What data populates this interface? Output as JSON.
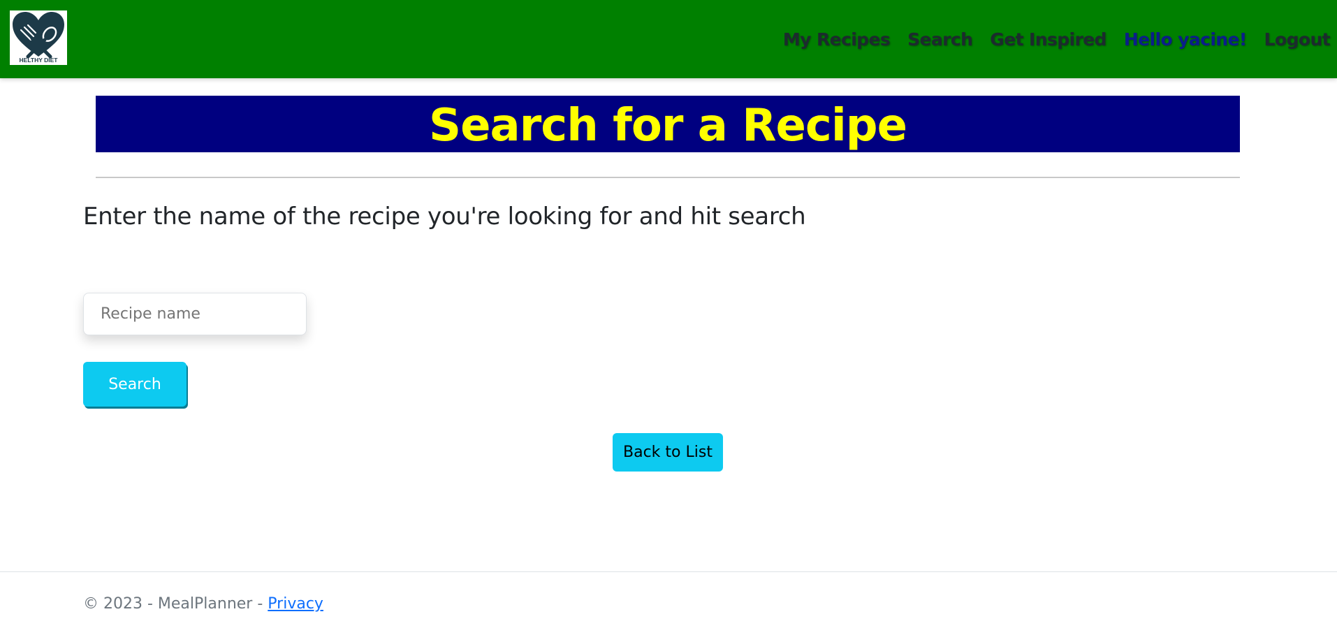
{
  "navbar": {
    "logo": {
      "icon": "heart-fork-spoon-logo",
      "text": "HELTHY DIET"
    },
    "links": [
      {
        "label": "My Recipes"
      },
      {
        "label": "Search"
      },
      {
        "label": "Get Inspired"
      },
      {
        "label": "Hello yacine!"
      },
      {
        "label": "Logout"
      }
    ],
    "colors": {
      "background": "#008000",
      "greeting": "#0b1e8a"
    }
  },
  "page": {
    "title": "Search for a Recipe",
    "subtitle": "Enter the name of the recipe you're looking for and hit search",
    "colors": {
      "title_background": "#000080",
      "title_text": "#ffff00"
    }
  },
  "search_form": {
    "input_value": "",
    "input_placeholder": "Recipe name",
    "submit_label": "Search"
  },
  "back_button": {
    "label": "Back to List",
    "color": "#0dcaf0"
  },
  "footer": {
    "copyright": "© 2023 - MealPlanner - ",
    "privacy_label": "Privacy"
  }
}
